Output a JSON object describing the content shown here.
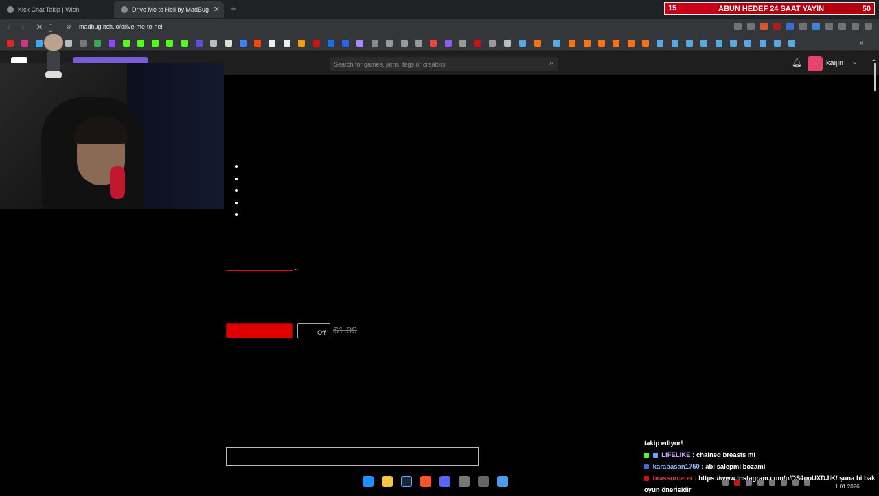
{
  "browser": {
    "tabs": [
      {
        "label": "Kick Chat Takip | Wich"
      },
      {
        "label": "Drive Me to Hell by MadBug"
      }
    ],
    "new_tab_glyph": "+",
    "url": "madbug.itch.io/drive-me-to-hell"
  },
  "stream_goal": {
    "left_value": "15",
    "title": "ABUN HEDEF 24 SAAT YAYIN",
    "right_value": "50"
  },
  "itch": {
    "search_placeholder": "Search for games, jams, tags or creators",
    "username": "kaijiri"
  },
  "product": {
    "off_label": "Off",
    "original_price": "$1.99"
  },
  "chat": [
    {
      "user": "",
      "message": "takip ediyor!"
    },
    {
      "user": "LIFELIKE",
      "message": ": chained breasts mi"
    },
    {
      "user": "karabasan1750",
      "message": ": abi salepmi bozami"
    },
    {
      "user": "brassorcerer",
      "message": ": https://www.instagram.com/p/DS4poUXDJiK/ şuna bi bak oyun önerisidir"
    }
  ],
  "system": {
    "date": "1.01.2026"
  },
  "colors": {
    "buy_button": "#de0000",
    "goal_bar": "#b3000f",
    "avatar": "#e5456b",
    "itch_purple": "#7b5cd6"
  }
}
